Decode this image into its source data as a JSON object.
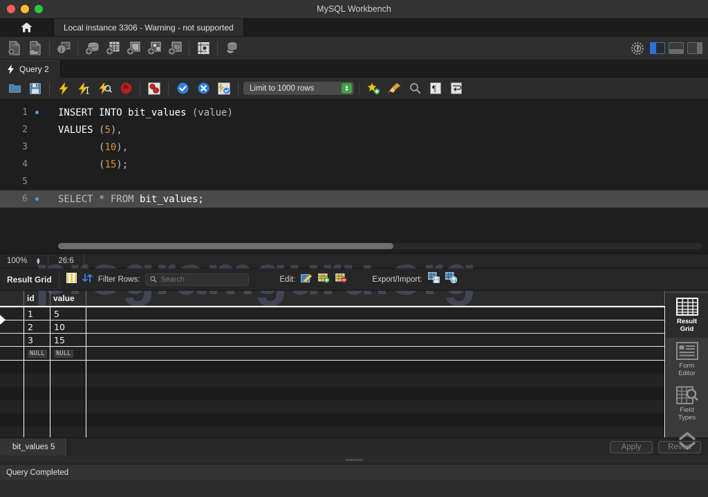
{
  "window": {
    "title": "MySQL Workbench",
    "traffic_lights": [
      "close",
      "minimize",
      "maximize"
    ]
  },
  "instance_bar": {
    "home_icon": "home-icon",
    "tab_label": "Local instance 3306 - Warning - not supported"
  },
  "main_toolbar": {
    "icons": [
      {
        "name": "new-sql-file-icon",
        "glyph": "SQL+"
      },
      {
        "name": "open-sql-file-icon",
        "glyph": "SQL↗"
      },
      {
        "name": "server-info-icon",
        "glyph": "i"
      },
      {
        "name": "new-schema-icon",
        "glyph": "DB+"
      },
      {
        "name": "new-table-icon",
        "glyph": "TBL+"
      },
      {
        "name": "new-view-icon",
        "glyph": "VW+"
      },
      {
        "name": "new-procedure-icon",
        "glyph": "PRC+"
      },
      {
        "name": "new-function-icon",
        "glyph": "FN+"
      },
      {
        "name": "search-data-icon",
        "glyph": "🔍"
      },
      {
        "name": "reconnect-server-icon",
        "glyph": "DB☝"
      }
    ],
    "right_icons": [
      {
        "name": "settings-gear-icon"
      },
      {
        "name": "toggle-sidebar-icon",
        "active": true
      },
      {
        "name": "toggle-output-icon",
        "active": false
      },
      {
        "name": "toggle-secondary-sidebar-icon",
        "active": false
      }
    ]
  },
  "query_tab": {
    "icon": "lightning-icon",
    "label": "Query 2"
  },
  "editor_toolbar": {
    "icons": [
      {
        "name": "open-file-icon"
      },
      {
        "name": "save-file-icon"
      },
      {
        "name": "execute-statement-icon"
      },
      {
        "name": "execute-current-statement-icon"
      },
      {
        "name": "explain-statement-icon"
      },
      {
        "name": "stop-execution-icon"
      },
      {
        "name": "toggle-breakpoint-icon"
      },
      {
        "name": "commit-transaction-icon"
      },
      {
        "name": "rollback-transaction-icon"
      },
      {
        "name": "toggle-autocommit-icon"
      }
    ],
    "limit_value": "Limit to 1000 rows",
    "right_icons": [
      {
        "name": "beautify-sql-icon"
      },
      {
        "name": "clear-context-icon"
      },
      {
        "name": "find-icon"
      },
      {
        "name": "toggle-invisible-chars-icon"
      },
      {
        "name": "toggle-word-wrap-icon"
      }
    ]
  },
  "editor": {
    "lines": [
      {
        "number": "1",
        "marker": true,
        "highlight": false,
        "tokens": [
          {
            "t": "INSERT INTO ",
            "c": "kw"
          },
          {
            "t": "bit_values",
            "c": "ident"
          },
          {
            "t": " (value)",
            "c": "punc"
          }
        ]
      },
      {
        "number": "2",
        "marker": false,
        "highlight": false,
        "tokens": [
          {
            "t": "VALUES ",
            "c": "kw"
          },
          {
            "t": "(",
            "c": "punc"
          },
          {
            "t": "5",
            "c": "num"
          },
          {
            "t": "),",
            "c": "punc"
          }
        ]
      },
      {
        "number": "3",
        "marker": false,
        "highlight": false,
        "tokens": [
          {
            "t": "       (",
            "c": "punc"
          },
          {
            "t": "10",
            "c": "num"
          },
          {
            "t": "),",
            "c": "punc"
          }
        ]
      },
      {
        "number": "4",
        "marker": false,
        "highlight": false,
        "tokens": [
          {
            "t": "       (",
            "c": "punc"
          },
          {
            "t": "15",
            "c": "num"
          },
          {
            "t": ");",
            "c": "punc"
          }
        ]
      },
      {
        "number": "5",
        "marker": false,
        "highlight": false,
        "tokens": []
      },
      {
        "number": "6",
        "marker": true,
        "highlight": true,
        "tokens": [
          {
            "t": "SELECT ",
            "c": "kw"
          },
          {
            "t": "* ",
            "c": "punc"
          },
          {
            "t": "FROM ",
            "c": "kw"
          },
          {
            "t": "bit_values;",
            "c": "ident"
          }
        ]
      }
    ]
  },
  "editor_status": {
    "zoom": "100%",
    "cursor_position": "26:6"
  },
  "result_toolbar": {
    "title": "Result Grid",
    "grid_view_icon": "grid-view-icon",
    "refresh_icon": "refresh-icon",
    "filter_label": "Filter Rows:",
    "search_placeholder": "Search",
    "search_value": "",
    "edit_label": "Edit:",
    "edit_icons": [
      {
        "name": "edit-row-icon"
      },
      {
        "name": "add-row-icon"
      },
      {
        "name": "delete-row-icon"
      }
    ],
    "export_label": "Export/Import:",
    "export_icons": [
      {
        "name": "export-recordset-icon"
      },
      {
        "name": "import-recordset-icon"
      }
    ]
  },
  "grid": {
    "columns": [
      "id",
      "value"
    ],
    "rows": [
      [
        "1",
        "5"
      ],
      [
        "2",
        "10"
      ],
      [
        "3",
        "15"
      ]
    ],
    "new_row": [
      "NULL",
      "NULL"
    ],
    "empty_row_count": 6
  },
  "right_sidebar": {
    "items": [
      {
        "label_line1": "Result",
        "label_line2": "Grid",
        "icon": "result-grid-icon",
        "active": true
      },
      {
        "label_line1": "Form",
        "label_line2": "Editor",
        "icon": "form-editor-icon",
        "active": false
      },
      {
        "label_line1": "Field",
        "label_line2": "Types",
        "icon": "field-types-icon",
        "active": false
      }
    ],
    "expander_icon": "double-chevron-icon"
  },
  "result_tabs": {
    "tab_label": "bit_values 5",
    "apply_label": "Apply",
    "revert_label": "Revert"
  },
  "status_bar": {
    "message": "Query Completed"
  },
  "watermark": {
    "text": "programguru.org"
  },
  "colors": {
    "accent_blue": "#2f6fdd",
    "number_orange": "#e8912d",
    "stepper_green": "#3fa23f",
    "marker_blue": "#4a9eff",
    "watermark": "#7e7ebe"
  }
}
